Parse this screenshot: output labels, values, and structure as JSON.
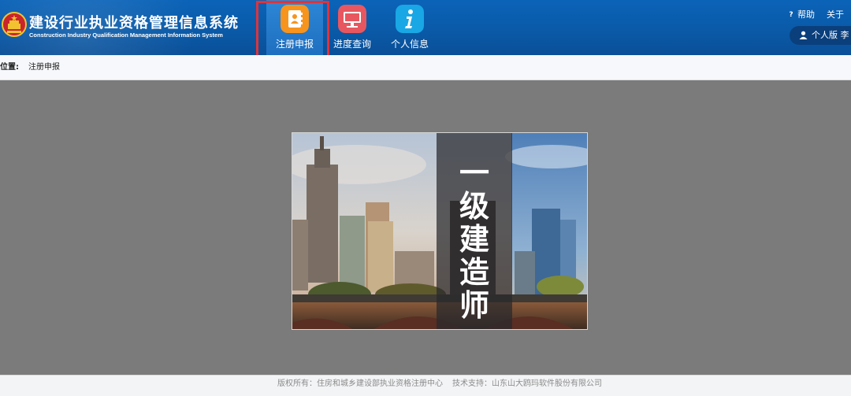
{
  "header": {
    "title_cn": "建设行业执业资格管理信息系统",
    "title_en": "Construction Industry Qualification Management Information System",
    "emblem": "national-emblem",
    "help_label": "帮助",
    "about_label": "关于",
    "user_label": "个人版",
    "user_name_partial": "李"
  },
  "nav": {
    "items": [
      {
        "label": "注册申报",
        "icon": "address-book-icon",
        "color": "#f7941d",
        "active": true
      },
      {
        "label": "进度查询",
        "icon": "monitor-icon",
        "color": "#e8575f",
        "active": false
      },
      {
        "label": "个人信息",
        "icon": "info-icon",
        "color": "#19a7e6",
        "active": false
      }
    ]
  },
  "breadcrumb": {
    "label": "位置:",
    "current": "注册申报"
  },
  "banner": {
    "chars": [
      "一",
      "级",
      "建",
      "造",
      "师"
    ]
  },
  "footer": {
    "copyright": "版权所有：住房和城乡建设部执业资格注册中心",
    "tech_support": "技术支持：山东山大鸥玛软件股份有限公司"
  },
  "colors": {
    "header_bg": "#0a5aa8",
    "highlight": "#e0333a",
    "content_bg": "#7b7b7b"
  }
}
